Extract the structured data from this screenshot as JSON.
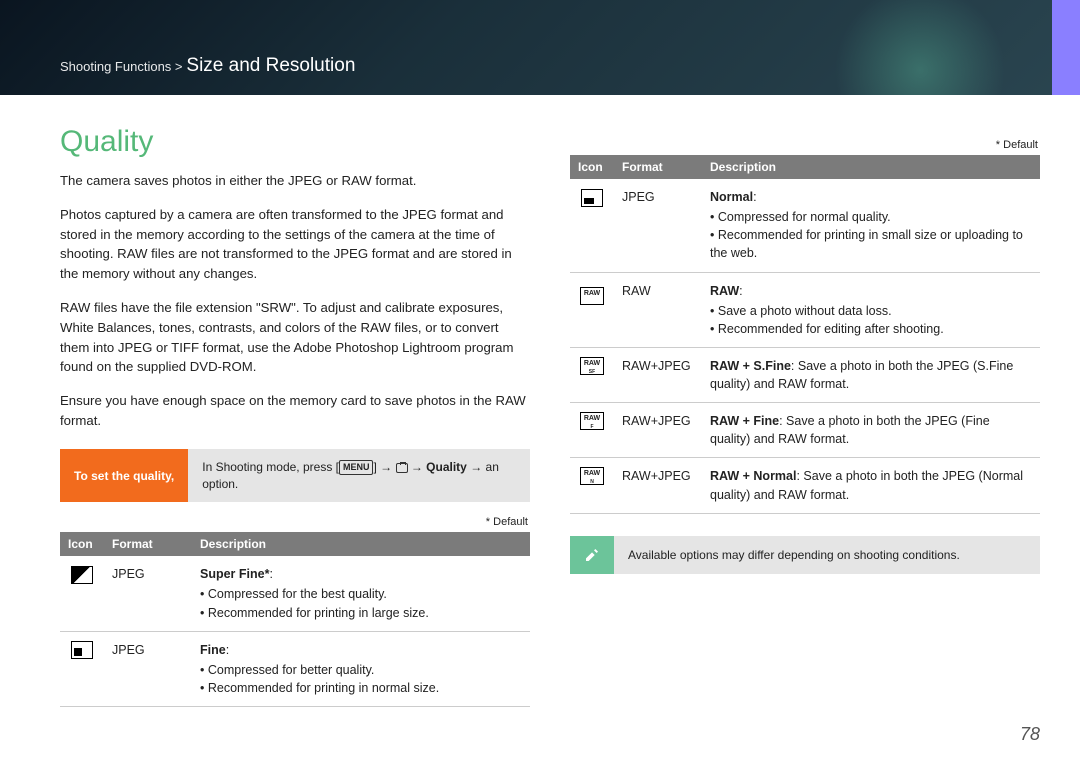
{
  "breadcrumb": {
    "category": "Shooting Functions >",
    "page": "Size and Resolution"
  },
  "section_title": "Quality",
  "paragraphs": {
    "p1": "The camera saves photos in either the JPEG or RAW format.",
    "p2": "Photos captured by a camera are often transformed to the JPEG format and stored in the memory according to the settings of the camera at the time of shooting. RAW files are not transformed to the JPEG format and are stored in the memory without any changes.",
    "p3": "RAW files have the file extension \"SRW\". To adjust and calibrate exposures, White Balances, tones, contrasts, and colors of the RAW files, or to convert them into JPEG or TIFF format, use the Adobe Photoshop Lightroom program found on the supplied DVD-ROM.",
    "p4": "Ensure you have enough space on the memory card to save photos in the RAW format."
  },
  "instruction": {
    "label": "To set the quality,",
    "body_prefix": "In Shooting mode, press [",
    "menu": "MENU",
    "body_mid1": "] → ",
    "body_mid2": " → ",
    "quality_word": "Quality",
    "body_suffix": " → an option."
  },
  "default_note": "* Default",
  "table_headers": {
    "icon": "Icon",
    "format": "Format",
    "description": "Description"
  },
  "table_left": [
    {
      "format": "JPEG",
      "title": "Super Fine*",
      "bullets": [
        "Compressed for the best quality.",
        "Recommended for printing in large size."
      ]
    },
    {
      "format": "JPEG",
      "title": "Fine",
      "bullets": [
        "Compressed for better quality.",
        "Recommended for printing in normal size."
      ]
    }
  ],
  "table_right": [
    {
      "format": "JPEG",
      "title": "Normal",
      "bullets": [
        "Compressed for normal quality.",
        "Recommended for printing in small size or uploading to the web."
      ]
    },
    {
      "format": "RAW",
      "title": "RAW",
      "bullets": [
        "Save a photo without data loss.",
        "Recommended for editing after shooting."
      ]
    },
    {
      "format": "RAW+JPEG",
      "title": "RAW + S.Fine",
      "desc": ": Save a photo in both the JPEG (S.Fine quality) and RAW format."
    },
    {
      "format": "RAW+JPEG",
      "title": "RAW + Fine",
      "desc": ": Save a photo in both the JPEG (Fine quality) and RAW format."
    },
    {
      "format": "RAW+JPEG",
      "title": "RAW + Normal",
      "desc": ": Save a photo in both the JPEG (Normal quality) and RAW format."
    }
  ],
  "note": "Available options may differ depending on shooting conditions.",
  "page_number": "78"
}
